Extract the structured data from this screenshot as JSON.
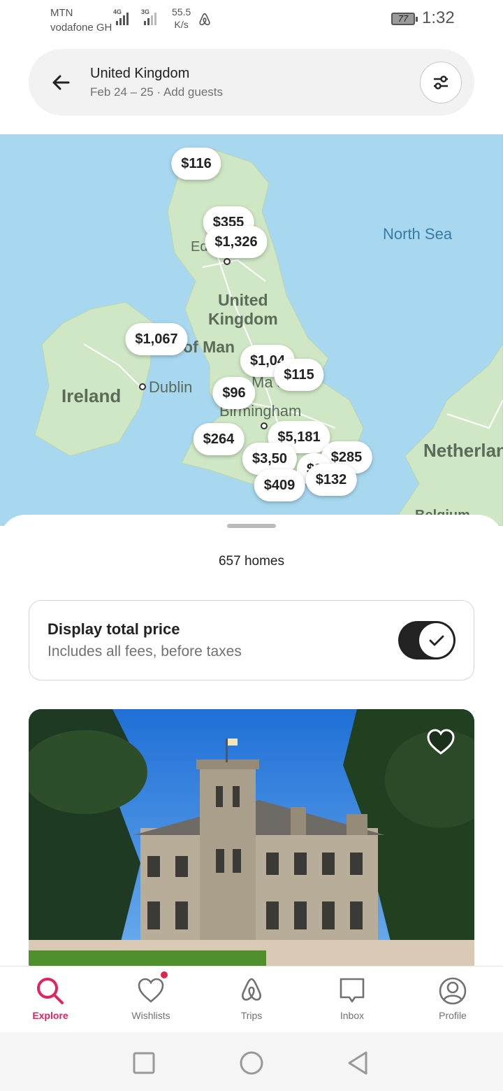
{
  "status_bar": {
    "carrier1": "MTN",
    "carrier2": "vodafone GH",
    "sim1_type": "4G",
    "sim2_type": "3G",
    "net_speed_value": "55.5",
    "net_speed_unit": "K/s",
    "battery": "77",
    "time": "1:32"
  },
  "search": {
    "location": "United Kingdom",
    "dates": "Feb 24 – 25",
    "separator": "·",
    "guests": "Add guests"
  },
  "map": {
    "labels": {
      "north_sea": "North Sea",
      "uk_line1": "United",
      "uk_line2": "Kingdom",
      "isle_of_man": "of Man",
      "ireland": "Ireland",
      "dublin": "Dublin",
      "manchester": "Ma     ster",
      "birmingham": "Birmingham",
      "netherlands": "Netherlan",
      "belgium": "Belgium",
      "edinburgh": "Ed"
    },
    "price_pins": [
      {
        "label": "$116"
      },
      {
        "label": "$355"
      },
      {
        "label": "$1,326"
      },
      {
        "label": "$1,067"
      },
      {
        "label": "$1,04"
      },
      {
        "label": "$115"
      },
      {
        "label": "$96"
      },
      {
        "label": "$264"
      },
      {
        "label": "$5,181"
      },
      {
        "label": "$3,50"
      },
      {
        "label": "$285"
      },
      {
        "label": "$2"
      },
      {
        "label": "$409"
      },
      {
        "label": "$132"
      }
    ]
  },
  "sheet": {
    "homes_count": "657 homes",
    "total_price": {
      "title": "Display total price",
      "subtitle": "Includes all fees, before taxes",
      "enabled": true
    }
  },
  "tabs": [
    {
      "label": "Explore",
      "icon": "search-icon",
      "active": true
    },
    {
      "label": "Wishlists",
      "icon": "heart-icon",
      "active": false
    },
    {
      "label": "Trips",
      "icon": "airbnb-icon",
      "active": false
    },
    {
      "label": "Inbox",
      "icon": "message-icon",
      "active": false
    },
    {
      "label": "Profile",
      "icon": "profile-icon",
      "active": false
    }
  ],
  "colors": {
    "accent": "#e0245e",
    "map_water": "#a8d8f0",
    "map_land": "#cfe7c4"
  }
}
